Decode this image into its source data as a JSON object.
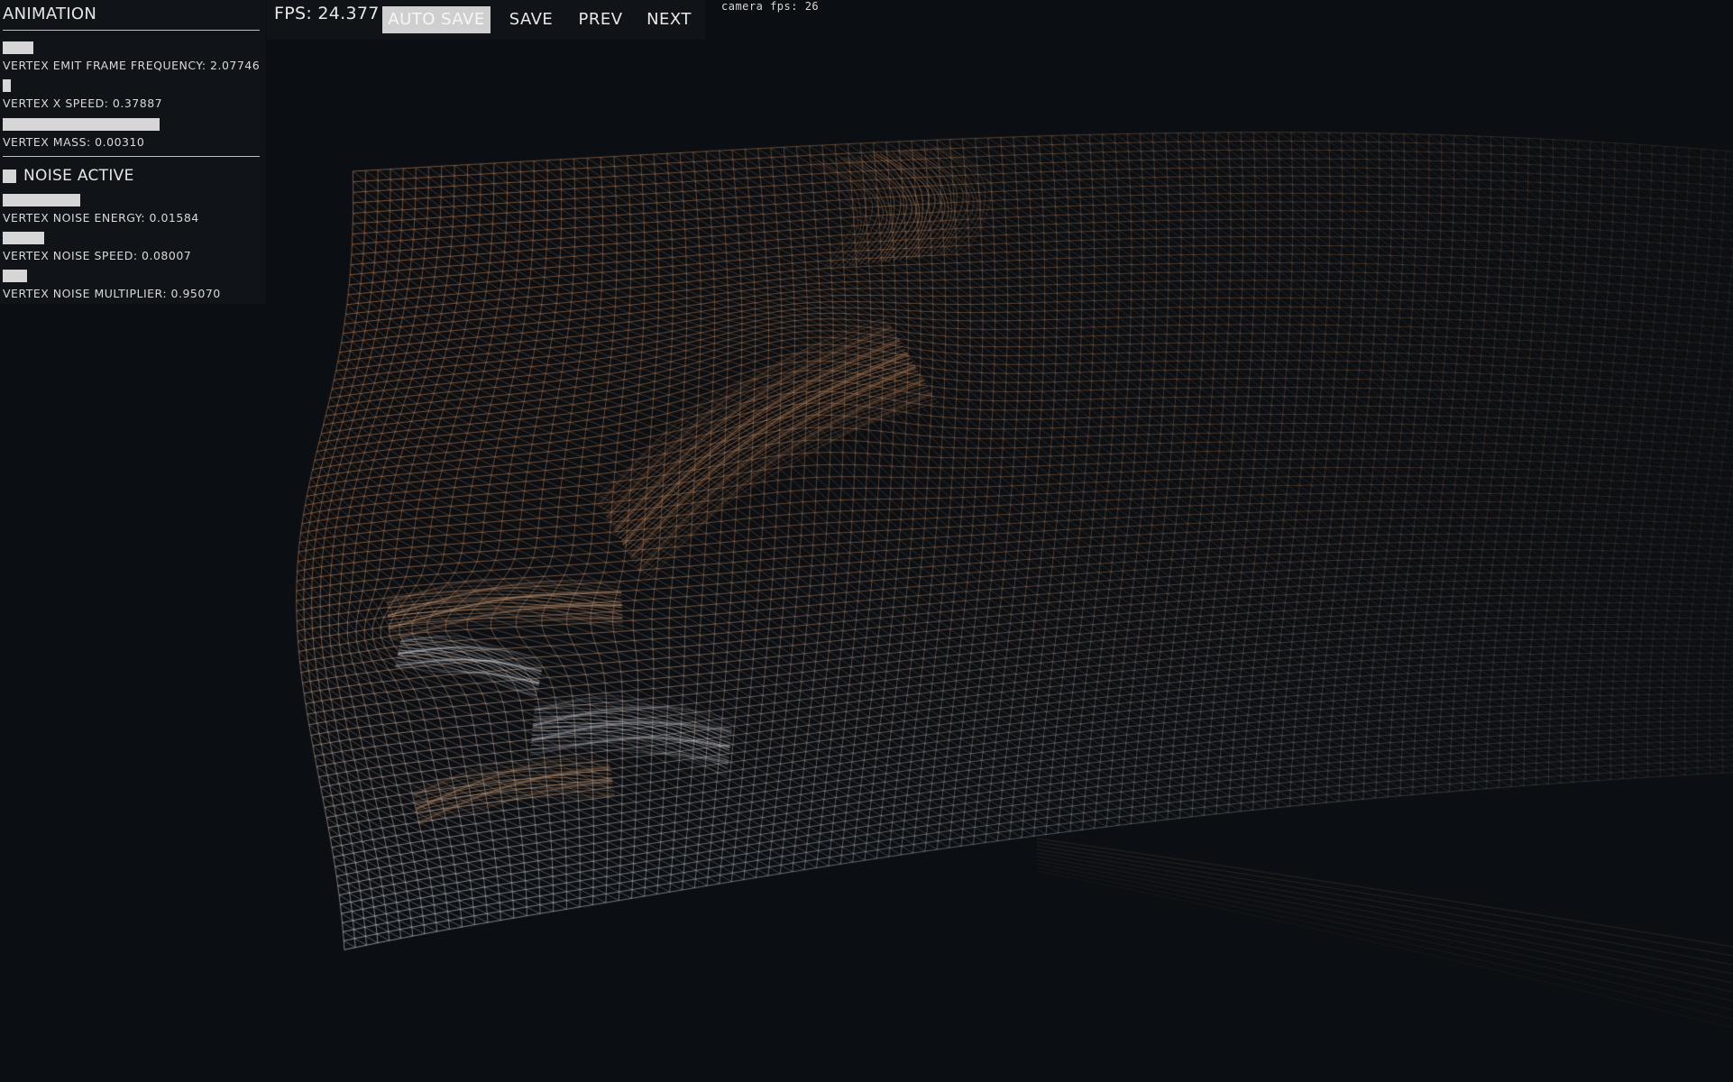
{
  "panel": {
    "title": "ANIMATION",
    "sliders_group1": [
      {
        "label": "VERTEX EMIT FRAME FREQUENCY: 2.07746",
        "fill": 0.12
      },
      {
        "label": "VERTEX X SPEED: 0.37887",
        "fill": 0.03
      },
      {
        "label": "VERTEX MASS: 0.00310",
        "fill": 0.61
      }
    ],
    "noise_toggle": {
      "label": "NOISE ACTIVE",
      "checked": true
    },
    "sliders_group2": [
      {
        "label": "VERTEX NOISE ENERGY: 0.01584",
        "fill": 0.3
      },
      {
        "label": "VERTEX NOISE SPEED: 0.08007",
        "fill": 0.16
      },
      {
        "label": "VERTEX NOISE MULTIPLIER: 0.95070",
        "fill": 0.095
      }
    ]
  },
  "toolbar": {
    "fps": "FPS: 24.377",
    "auto_save": "AUTO SAVE",
    "save": "SAVE",
    "prev": "PREV",
    "next": "NEXT"
  },
  "camera_fps": "camera fps: 26",
  "colors": {
    "background": "#0b0e12",
    "panel": "#101318",
    "control": "#d6d6d6",
    "mesh_warm": "#b77a4e",
    "mesh_cool": "#c7ccd4"
  }
}
